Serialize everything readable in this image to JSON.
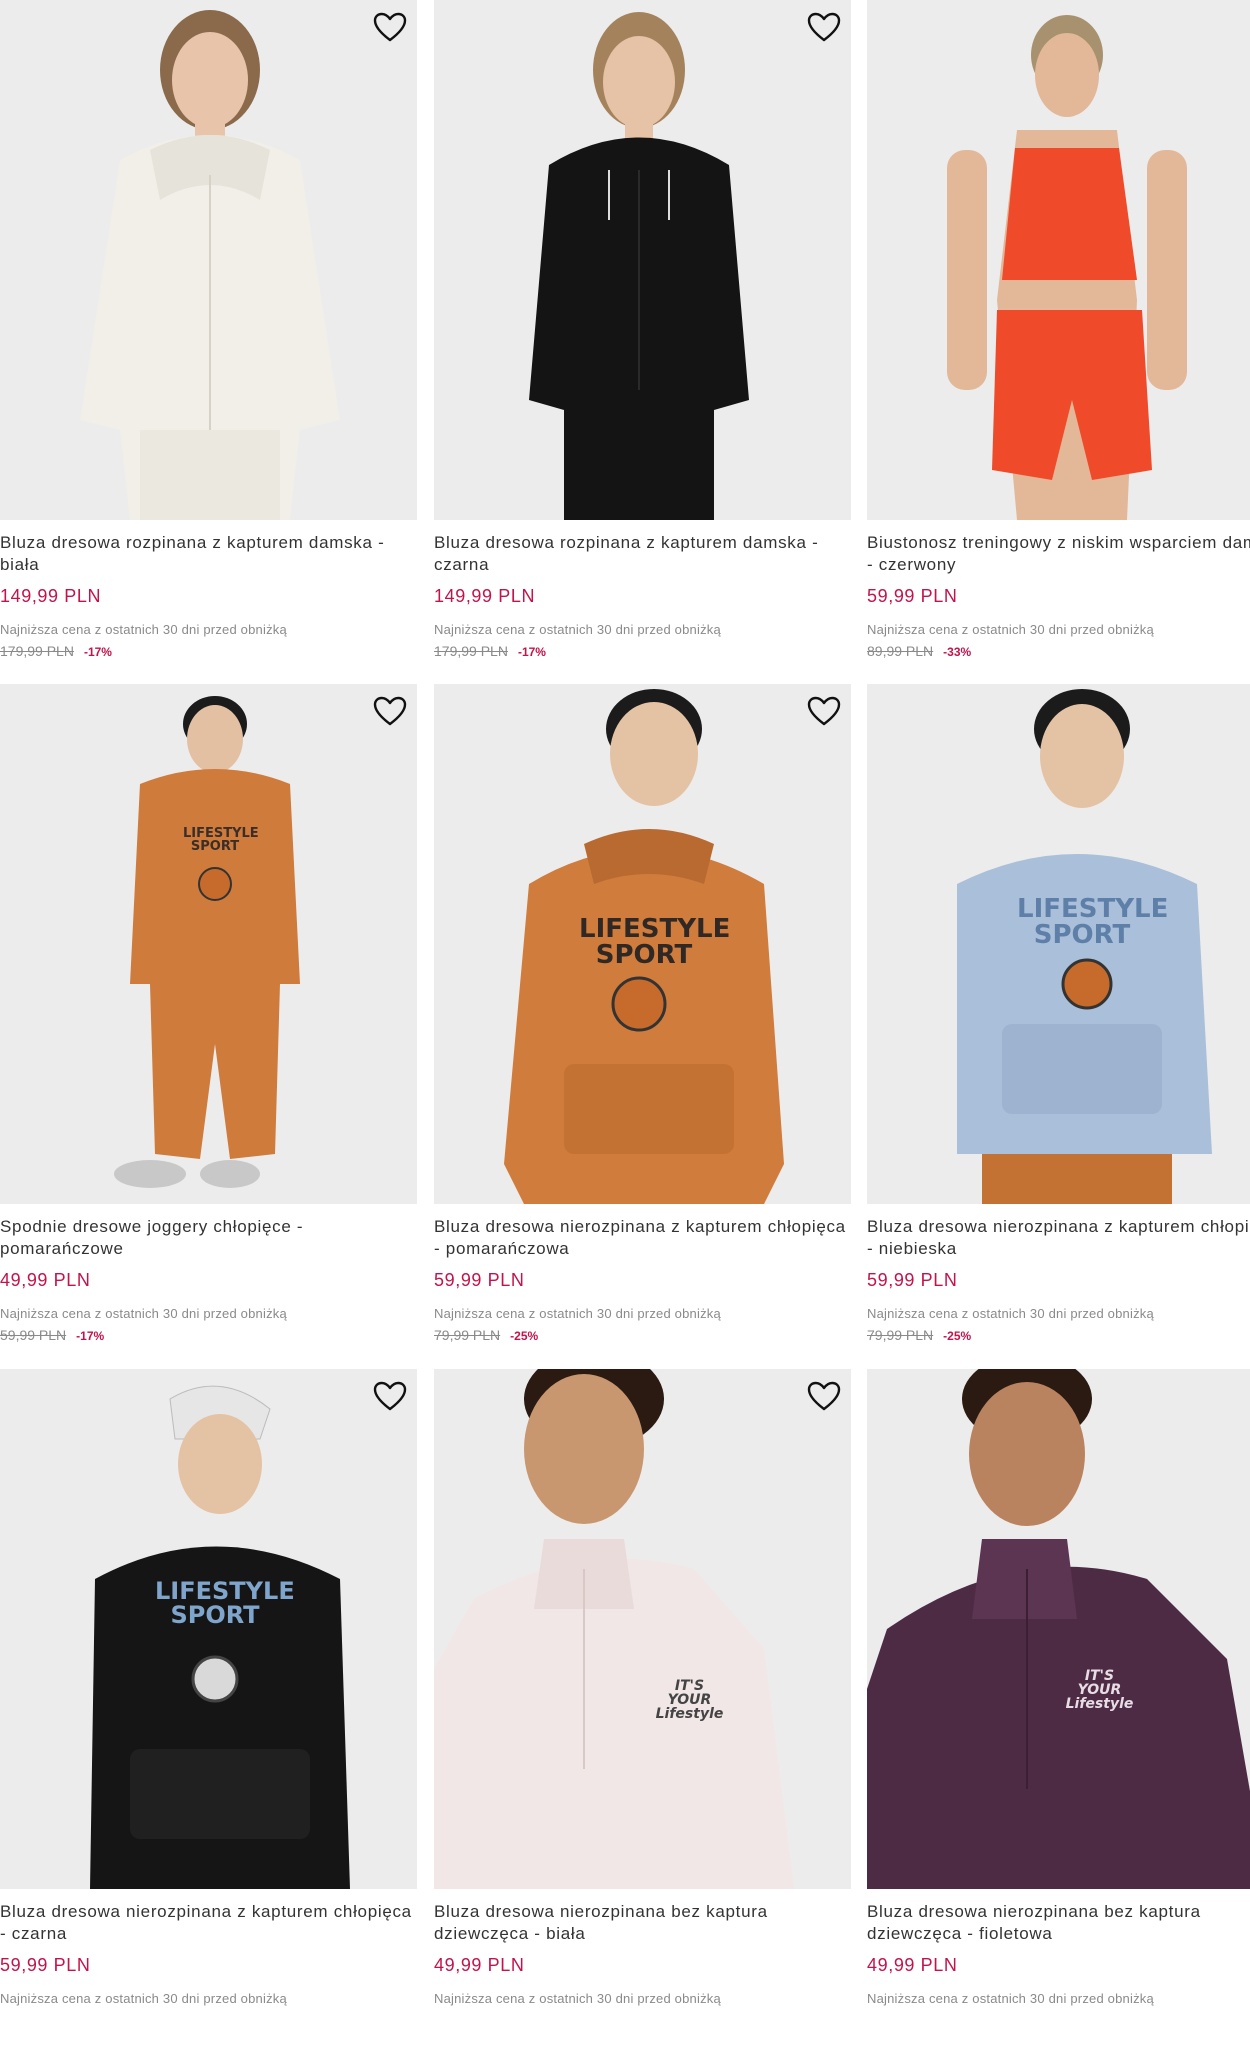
{
  "colors": {
    "price": "#c4124a",
    "discount": "#c4124a",
    "muted_text": "#8a8a8a",
    "photo_background": "#ececec"
  },
  "lowest_price_note": "Najniższa cena z ostatnich 30 dni przed obniżką",
  "wishlist_icon": "heart-outline-icon",
  "products": [
    {
      "title": "Bluza dresowa rozpinana z kapturem damska - biała",
      "price": "149,99 PLN",
      "old_price": "179,99 PLN",
      "discount": "-17%",
      "garment_color": "#f1efe8",
      "skin_color": "#e8c4aa",
      "hair_color": "#8a6a4a"
    },
    {
      "title": "Bluza dresowa rozpinana z kapturem damska - czarna",
      "price": "149,99 PLN",
      "old_price": "179,99 PLN",
      "discount": "-17%",
      "garment_color": "#141414",
      "skin_color": "#e6c2a6",
      "hair_color": "#a4835c"
    },
    {
      "title": "Biustonosz treningowy z niskim wsparciem damski - czerwony",
      "price": "59,99 PLN",
      "old_price": "89,99 PLN",
      "discount": "-33%",
      "garment_color": "#ef4a2a",
      "skin_color": "#e2b898",
      "hair_color": "#a8916e"
    },
    {
      "title": "Spodnie dresowe joggery chłopięce - pomarańczowe",
      "price": "49,99 PLN",
      "old_price": "59,99 PLN",
      "discount": "-17%",
      "garment_color": "#cf7b3b",
      "skin_color": "#e3c0a2",
      "hair_color": "#1b1b1b",
      "print": "LIFESTYLE SPORT"
    },
    {
      "title": "Bluza dresowa nierozpinana z kapturem chłopięca - pomarańczowa",
      "price": "59,99 PLN",
      "old_price": "79,99 PLN",
      "discount": "-25%",
      "garment_color": "#d07c3c",
      "skin_color": "#e4c2a4",
      "hair_color": "#1b1b1b",
      "print": "LIFESTYLE SPORT"
    },
    {
      "title": "Bluza dresowa nierozpinana z kapturem chłopięca - niebieska",
      "price": "59,99 PLN",
      "old_price": "79,99 PLN",
      "discount": "-25%",
      "garment_color": "#aabfd9",
      "skin_color": "#e4c2a4",
      "hair_color": "#1b1b1b",
      "print": "LIFESTYLE SPORT"
    },
    {
      "title": "Bluza dresowa nierozpinana z kapturem chłopięca - czarna",
      "price": "59,99 PLN",
      "old_price": "",
      "discount": "",
      "garment_color": "#151515",
      "skin_color": "#e4c2a4",
      "hair_color": "#1b1b1b",
      "print": "LIFESTYLE SPORT"
    },
    {
      "title": "Bluza dresowa nierozpinana bez kaptura dziewczęca - biała",
      "price": "49,99 PLN",
      "old_price": "",
      "discount": "",
      "garment_color": "#f1e7e6",
      "skin_color": "#c8976f",
      "hair_color": "#2a1a12",
      "print": "IT'S YOUR Lifestyle"
    },
    {
      "title": "Bluza dresowa nierozpinana bez kaptura dziewczęca - fioletowa",
      "price": "49,99 PLN",
      "old_price": "",
      "discount": "",
      "garment_color": "#4e2b45",
      "skin_color": "#b98360",
      "hair_color": "#2a1a12",
      "print": "IT'S YOUR Lifestyle"
    }
  ]
}
